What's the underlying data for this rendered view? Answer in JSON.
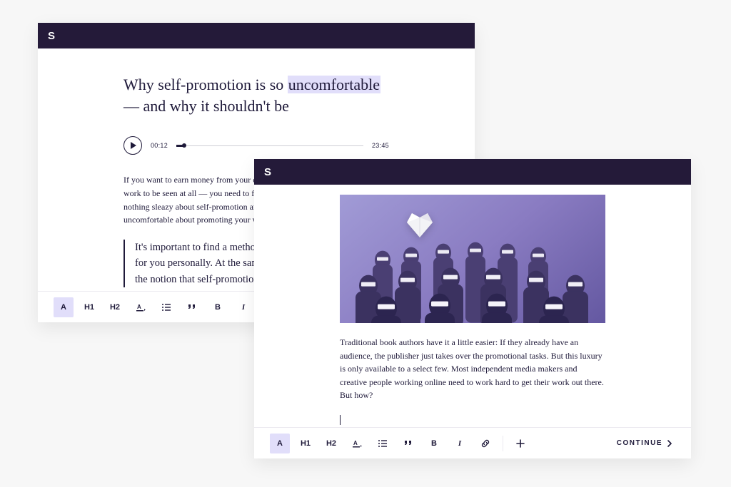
{
  "colors": {
    "titlebar": "#241a39",
    "accent": "#e1defa",
    "text": "#1f1a3a"
  },
  "logo_text": "S",
  "windowA": {
    "title_pre": "Why self-promotion is so ",
    "title_hi": "uncomfortable",
    "title_post": " — and why it shouldn't be",
    "audio": {
      "current": "00:12",
      "total": "23:45"
    },
    "paragraph": "If you want to earn money from your creative work — and if you want your work to be seen at all — you need to find ways to promote it. Why there's nothing sleazy about self-promotion and why you shouldn't feel uncomfortable about promoting your work.",
    "quote": "It's important to find a method of self-promotion that works for you personally. At the same time, you should throw away the notion that self-promotion is a bad thing."
  },
  "windowB": {
    "paragraph": "Traditional book authors have it a little easier: If they already have an audience, the publisher just takes over the promotional tasks. But this luxury is only available to a select few. Most independent media makers and creative people working online need to work hard to get their work out there. But how?"
  },
  "toolbar": {
    "p": "A",
    "h1": "H1",
    "h2": "H2",
    "bold": "B",
    "italic": "I"
  },
  "continue_label": "CONTINUE"
}
